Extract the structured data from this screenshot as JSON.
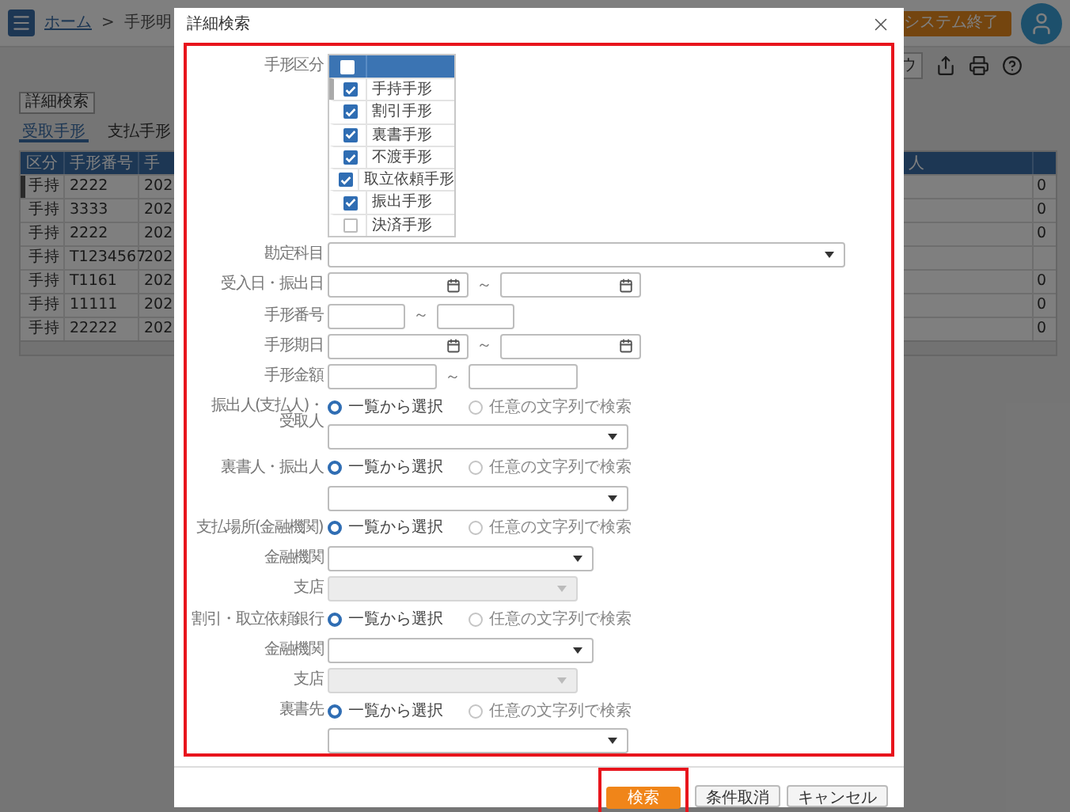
{
  "app": {
    "breadcrumb": {
      "home": "ホーム",
      "separator": ">",
      "current": "手形明"
    },
    "exit_button": "システム終了",
    "toolbar_text": "ウ",
    "detail_search_button": "詳細検索",
    "tabs": [
      {
        "label": "受取手形",
        "selected": true
      },
      {
        "label": "支払手形",
        "selected": false
      }
    ],
    "table": {
      "columns": [
        "区分",
        "手形番号",
        "手"
      ],
      "column_cut": "人",
      "rows": [
        {
          "cells": [
            "手持",
            "2222",
            "202"
          ],
          "last": "0",
          "current": true
        },
        {
          "cells": [
            "手持",
            "3333",
            "202"
          ],
          "last": "0",
          "current": false
        },
        {
          "cells": [
            "手持",
            "2222",
            "202"
          ],
          "last": "0",
          "current": false
        },
        {
          "cells": [
            "手持",
            "T1234567",
            "202"
          ],
          "current": false
        },
        {
          "cells": [
            "手持",
            "T1161",
            "202"
          ],
          "last": "0",
          "current": false
        },
        {
          "cells": [
            "手持",
            "11111",
            "202"
          ],
          "last": "0",
          "current": false
        },
        {
          "cells": [
            "手持",
            "22222",
            "202"
          ],
          "last": "0",
          "current": false
        }
      ]
    }
  },
  "dialog": {
    "title": "詳細検索",
    "highlighted": true,
    "fields": [
      {
        "kind": "checklist",
        "label": "手形区分",
        "all_checked": false,
        "items": [
          {
            "label": "手持手形",
            "checked": true,
            "focused": true
          },
          {
            "label": "割引手形",
            "checked": true,
            "focused": false
          },
          {
            "label": "裏書手形",
            "checked": true,
            "focused": false
          },
          {
            "label": "不渡手形",
            "checked": true,
            "focused": false
          },
          {
            "label": "取立依頼手形",
            "checked": true,
            "focused": false
          },
          {
            "label": "振出手形",
            "checked": true,
            "focused": false
          },
          {
            "label": "決済手形",
            "checked": false,
            "focused": false
          }
        ]
      },
      {
        "kind": "select",
        "label": "勘定科目",
        "disabled": false
      },
      {
        "kind": "date_range",
        "label": "受入日・振出日",
        "separator": "～"
      },
      {
        "kind": "text_range",
        "label": "手形番号",
        "separator": "～"
      },
      {
        "kind": "date_range",
        "label": "手形期日",
        "separator": "～"
      },
      {
        "kind": "text_range",
        "label": "手形金額",
        "separator": "～"
      },
      {
        "kind": "radio",
        "label": "振出人(支払人)・受取人",
        "options": [
          {
            "label": "一覧から選択",
            "selected": true
          },
          {
            "label": "任意の文字列で検索",
            "selected": false
          }
        ]
      },
      {
        "kind": "select",
        "disabled": false
      },
      {
        "kind": "radio",
        "label": "裏書人・振出人",
        "options": [
          {
            "label": "一覧から選択",
            "selected": true
          },
          {
            "label": "任意の文字列で検索",
            "selected": false
          }
        ]
      },
      {
        "kind": "select",
        "disabled": false
      },
      {
        "kind": "radio",
        "label": "支払場所(金融機関)",
        "options": [
          {
            "label": "一覧から選択",
            "selected": true
          },
          {
            "label": "任意の文字列で検索",
            "selected": false
          }
        ]
      },
      {
        "kind": "select",
        "label": "金融機関",
        "disabled": false
      },
      {
        "kind": "select",
        "label": "支店",
        "disabled": true
      },
      {
        "kind": "radio",
        "label": "割引・取立依頼銀行",
        "options": [
          {
            "label": "一覧から選択",
            "selected": true
          },
          {
            "label": "任意の文字列で検索",
            "selected": false
          }
        ]
      },
      {
        "kind": "select",
        "label": "金融機関",
        "disabled": false
      },
      {
        "kind": "select",
        "label": "支店",
        "disabled": true
      },
      {
        "kind": "radio",
        "label": "裏書先",
        "options": [
          {
            "label": "一覧から選択",
            "selected": true
          },
          {
            "label": "任意の文字列で検索",
            "selected": false
          }
        ]
      },
      {
        "kind": "select",
        "disabled": false
      }
    ],
    "buttons": [
      {
        "label": "検索",
        "kind": "primary",
        "highlighted": true
      },
      {
        "label": "条件取消",
        "kind": "secondary",
        "highlighted": false
      },
      {
        "label": "キャンセル",
        "kind": "secondary",
        "highlighted": false
      }
    ]
  }
}
